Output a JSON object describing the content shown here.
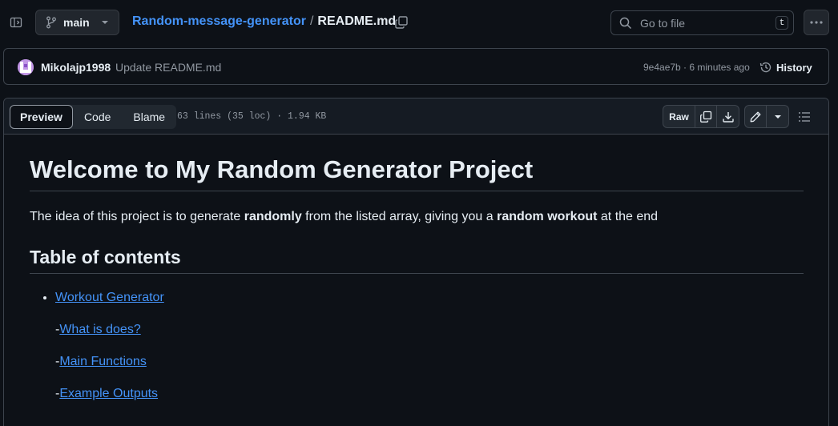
{
  "header": {
    "branch": "main",
    "repo": "Random-message-generator",
    "separator": "/",
    "file": "README.md",
    "search_placeholder": "Go to file",
    "search_shortcut": "t"
  },
  "commit": {
    "author": "Mikolajp1998",
    "message": "Update README.md",
    "meta": "9e4ae7b · 6 minutes ago",
    "history_label": "History"
  },
  "file_header": {
    "tabs": [
      "Preview",
      "Code",
      "Blame"
    ],
    "info": "63 lines (35 loc) · 1.94 KB",
    "raw_label": "Raw"
  },
  "readme": {
    "title": "Welcome to My Random Generator Project",
    "intro_pre": "The idea of this project is to generate ",
    "intro_bold1": "randomly",
    "intro_mid": " from the listed array, giving you a ",
    "intro_bold2": "random workout",
    "intro_post": " at the end",
    "toc_heading": "Table of contents",
    "toc_main": "Workout Generator",
    "dash": "-",
    "toc_items": [
      "What is does?",
      "Main Functions",
      "Example Outputs"
    ]
  },
  "colors": {
    "background": "#0d1117",
    "link": "#4493f8",
    "muted": "#9198a1",
    "border": "#3d444d"
  }
}
